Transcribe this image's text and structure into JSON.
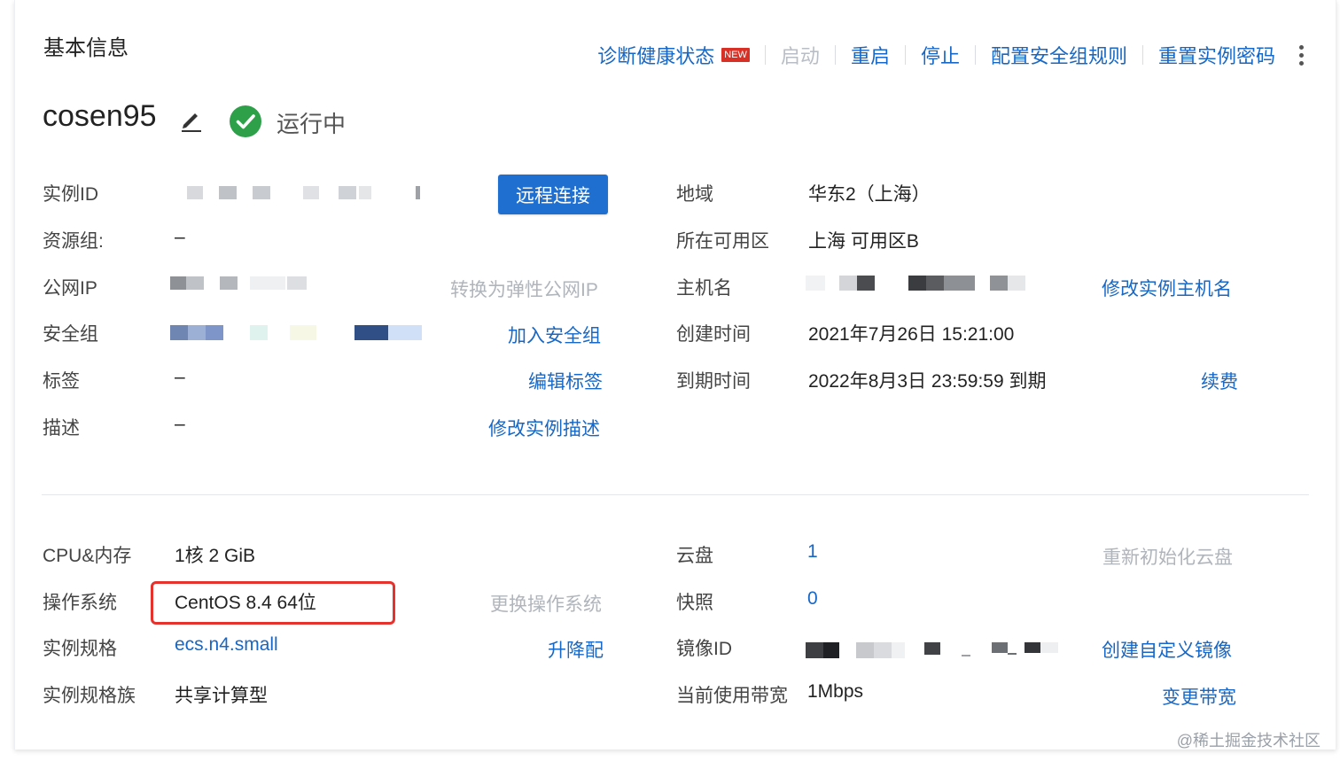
{
  "section": {
    "title": "基本信息"
  },
  "toolbar": {
    "diagnose": "诊断健康状态",
    "new_badge": "NEW",
    "start": "启动",
    "restart": "重启",
    "stop": "停止",
    "security_rules": "配置安全组规则",
    "reset_password": "重置实例密码"
  },
  "instance": {
    "name": "cosen95",
    "status": "运行中"
  },
  "left_fields": {
    "instance_id": {
      "label": "实例ID"
    },
    "remote_connect": "远程连接",
    "resource_group": {
      "label": "资源组:",
      "value": "–"
    },
    "public_ip": {
      "label": "公网IP",
      "action": "转换为弹性公网IP"
    },
    "security_group": {
      "label": "安全组",
      "action": "加入安全组"
    },
    "tags": {
      "label": "标签",
      "value": "–",
      "action": "编辑标签"
    },
    "description": {
      "label": "描述",
      "value": "–",
      "action": "修改实例描述"
    }
  },
  "right_fields": {
    "region": {
      "label": "地域",
      "value": "华东2（上海）"
    },
    "zone": {
      "label": "所在可用区",
      "value": "上海 可用区B"
    },
    "hostname": {
      "label": "主机名",
      "action": "修改实例主机名"
    },
    "created": {
      "label": "创建时间",
      "value": "2021年7月26日 15:21:00"
    },
    "expires": {
      "label": "到期时间",
      "value": "2022年8月3日 23:59:59 到期",
      "action": "续费"
    }
  },
  "config_left": {
    "cpu_mem": {
      "label": "CPU&内存",
      "value": "1核 2 GiB"
    },
    "os": {
      "label": "操作系统",
      "value": "CentOS 8.4 64位",
      "action": "更换操作系统"
    },
    "spec": {
      "label": "实例规格",
      "value": "ecs.n4.small",
      "action": "升降配"
    },
    "spec_family": {
      "label": "实例规格族",
      "value": "共享计算型"
    }
  },
  "config_right": {
    "disk": {
      "label": "云盘",
      "value": "1",
      "action": "重新初始化云盘"
    },
    "snapshot": {
      "label": "快照",
      "value": "0"
    },
    "image_id": {
      "label": "镜像ID",
      "action": "创建自定义镜像"
    },
    "bandwidth": {
      "label": "当前使用带宽",
      "value": "1Mbps",
      "action": "变更带宽"
    }
  },
  "watermark": "@稀土掘金技术社区",
  "colors": {
    "link": "#1767c6",
    "primary_button": "#1f6fd1",
    "success": "#2ea04a",
    "highlight": "#e5322d",
    "new_badge": "#d93026"
  }
}
